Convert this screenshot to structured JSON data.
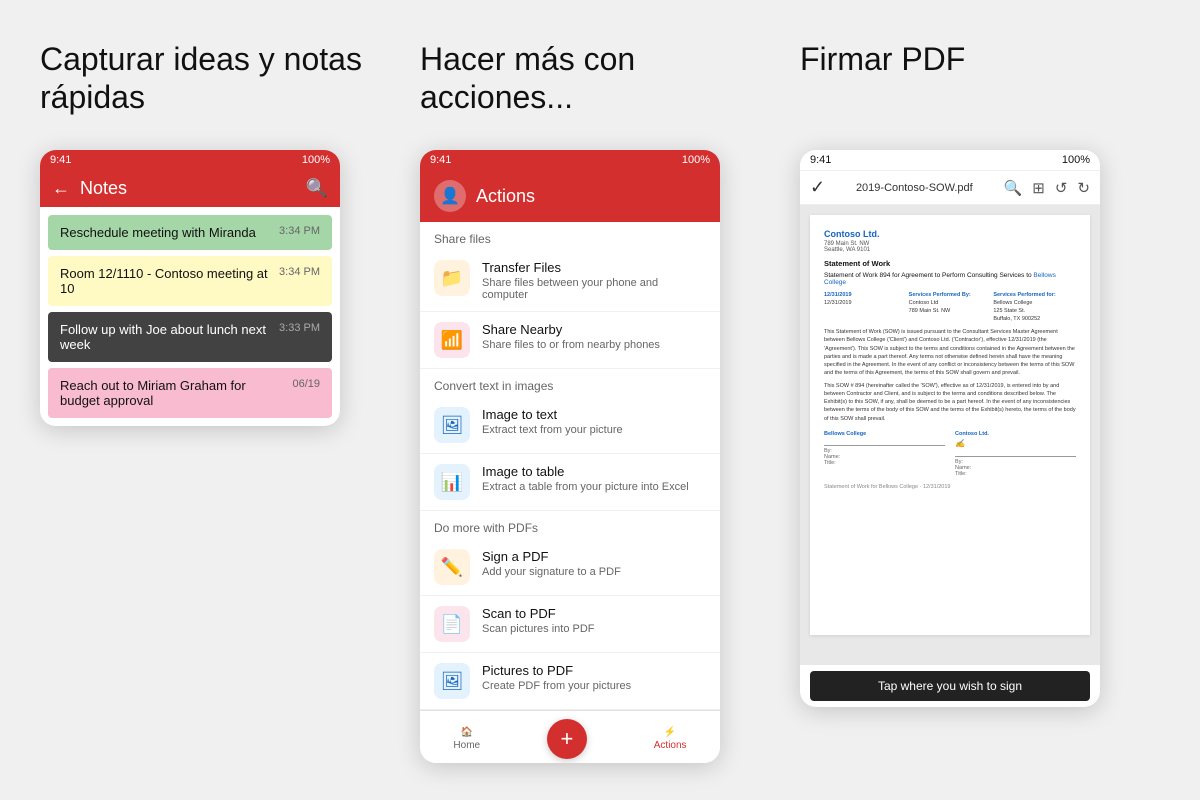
{
  "panel1": {
    "heading": "Capturar ideas y notas rápidas",
    "status": {
      "time": "9:41",
      "battery": "100%"
    },
    "toolbar": {
      "title": "Notes",
      "back": "←",
      "search": "🔍"
    },
    "notes": [
      {
        "text": "Reschedule meeting with Miranda",
        "time": "3:34 PM",
        "style": "green"
      },
      {
        "text": "Room 12/1110 - Contoso meeting at 10",
        "time": "3:34 PM",
        "style": "yellow"
      },
      {
        "text": "Follow up with Joe about lunch next week",
        "time": "3:33 PM",
        "style": "dark"
      },
      {
        "text": "Reach out to Miriam Graham for budget approval",
        "time": "06/19",
        "style": "pink"
      }
    ]
  },
  "panel2": {
    "heading": "Hacer más con acciones...",
    "status": {
      "time": "9:41",
      "battery": "100%"
    },
    "toolbar": {
      "title": "Actions"
    },
    "sections": [
      {
        "header": "Share files",
        "items": [
          {
            "icon": "📁",
            "iconStyle": "orange",
            "title": "Transfer Files",
            "desc": "Share files between your phone and computer"
          },
          {
            "icon": "📶",
            "iconStyle": "red",
            "title": "Share Nearby",
            "desc": "Share files to or from nearby phones"
          }
        ]
      },
      {
        "header": "Convert text in images",
        "items": [
          {
            "icon": "🖼",
            "iconStyle": "blue",
            "title": "Image to text",
            "desc": "Extract text from your picture"
          },
          {
            "icon": "📊",
            "iconStyle": "blue",
            "title": "Image to table",
            "desc": "Extract a table from your picture into Excel"
          }
        ]
      },
      {
        "header": "Do more with PDFs",
        "items": [
          {
            "icon": "✏️",
            "iconStyle": "orange",
            "title": "Sign a PDF",
            "desc": "Add your signature to a PDF"
          },
          {
            "icon": "📄",
            "iconStyle": "red",
            "title": "Scan to PDF",
            "desc": "Scan pictures into PDF"
          },
          {
            "icon": "🖼",
            "iconStyle": "blue",
            "title": "Pictures to PDF",
            "desc": "Create PDF from your pictures"
          }
        ]
      }
    ],
    "bottomBar": [
      {
        "icon": "🏠",
        "label": "Home",
        "active": false
      },
      {
        "icon": "+",
        "label": "",
        "fab": true
      },
      {
        "icon": "⚡",
        "label": "Actions",
        "active": true
      }
    ]
  },
  "panel3": {
    "heading": "Firmar PDF",
    "status": {
      "time": "9:41",
      "battery": "100%"
    },
    "toolbar": {
      "filename": "2019-Contoso-SOW.pdf",
      "icons": [
        "✓",
        "🔍",
        "⊞",
        "↺",
        "↻"
      ]
    },
    "doc": {
      "company": "Contoso Ltd.",
      "address": "789 Main St. NW\nSeattle, WA 9101",
      "sowTitle": "Statement of Work",
      "sowHeading": "Statement of Work 894 for Agreement to Perform Consulting Services to Bellows College",
      "infoGrid": [
        [
          "12/31/2019",
          "Services Performed By:",
          "Services Performed for:"
        ],
        [
          "12/31/2019",
          "Contoso Ltd",
          "Bellows College"
        ],
        [
          "",
          "789 Main St. NW",
          "125 State St."
        ],
        [
          "",
          "",
          "Buffalo, TX 900252"
        ]
      ],
      "body1": "This Statement of Work (SOW) is issued pursuant to the Consultant Services Master Agreement between Bellows College ('Client') and Contoso Ltd. ('Contractor'), effective 12/31/2019 (the 'Agreement'). This SOW is subject to the terms and conditions contained in the Agreement between the parties and is made a part thereof. Any terms not otherwise defined herein shall have the meaning specified in the Agreement. In the event of any conflict or inconsistency between the terms of this SOW and the terms of this Agreement, the terms of this SOW shall govern and prevail.",
      "body2": "This SOW # 894 (hereinafter called the 'SOW'), effective as of 12/31/2019, is entered into by and between Contractor and Client, and is subject to the terms and conditions described below. The Exhibit(s) to this SOW, if any, shall be deemed to be a part hereof. In the event of any inconsistencies between the terms of the body of this SOW and the terms of the Exhibit(s) hereto, the terms of the body of this SOW shall prevail.",
      "sigLeft": {
        "label": "Bellows College",
        "name": "Name:",
        "title": "Title:"
      },
      "sigRight": {
        "label": "Contoso Ltd.",
        "name": "Name:",
        "title": "Title:"
      },
      "footer": "Statement of Work for Bellows College · 12/31/2019"
    },
    "tapToSign": "Tap where you wish to sign"
  }
}
